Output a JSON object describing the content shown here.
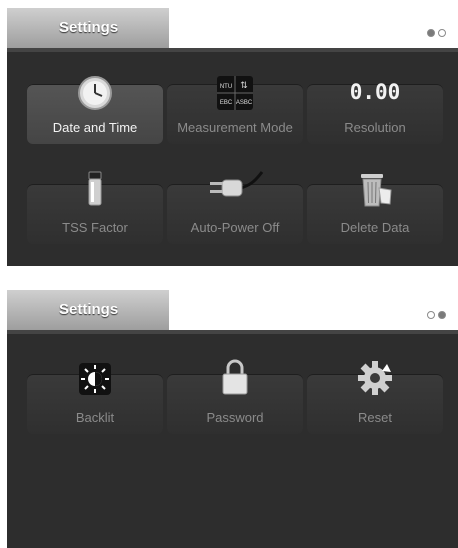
{
  "screens": [
    {
      "title": "Settings",
      "page_indicator": {
        "pages": 2,
        "current": 1
      },
      "tiles": [
        {
          "label": "Date and Time",
          "icon": "clock-icon",
          "selected": true
        },
        {
          "label": "Measurement Mode",
          "icon": "measurement-mode-icon",
          "icon_text": [
            "NTU",
            "EBC",
            "ASBC"
          ]
        },
        {
          "label": "Resolution",
          "icon": "resolution-icon",
          "icon_text": "0.00"
        },
        {
          "label": "TSS Factor",
          "icon": "vial-icon"
        },
        {
          "label": "Auto-Power Off",
          "icon": "power-plug-icon"
        },
        {
          "label": "Delete Data",
          "icon": "trash-icon"
        }
      ]
    },
    {
      "title": "Settings",
      "page_indicator": {
        "pages": 2,
        "current": 2
      },
      "tiles": [
        {
          "label": "Backlit",
          "icon": "brightness-icon"
        },
        {
          "label": "Password",
          "icon": "lock-icon"
        },
        {
          "label": "Reset",
          "icon": "reset-icon"
        }
      ]
    }
  ],
  "colors": {
    "background": "#2d2d2d",
    "tile": "#383838",
    "tile_selected": "#4f4f4f",
    "label": "#8b8b8b",
    "label_selected": "#f3f3f3"
  }
}
